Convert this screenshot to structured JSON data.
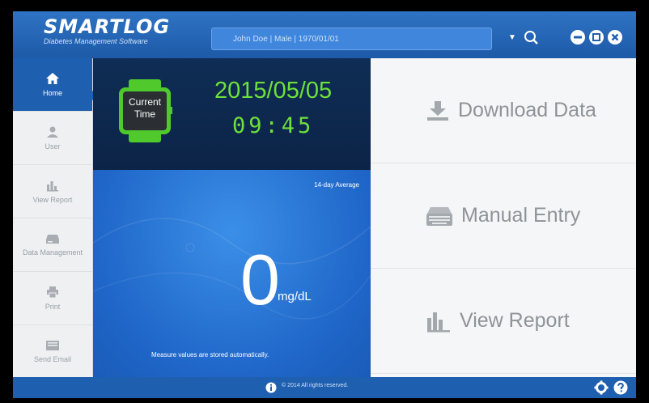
{
  "app": {
    "title": "SMARTLOG",
    "subtitle": "Diabetes Management Software"
  },
  "user_bar": {
    "text": "John Doe  |  Male  |  1970/01/01"
  },
  "sidebar": {
    "items": [
      {
        "label": "Home",
        "icon": "home-icon",
        "active": true
      },
      {
        "label": "User",
        "icon": "user-icon",
        "active": false
      },
      {
        "label": "View Report",
        "icon": "chart-icon",
        "active": false
      },
      {
        "label": "Data Management",
        "icon": "data-management-icon",
        "active": false
      },
      {
        "label": "Print",
        "icon": "printer-icon",
        "active": false
      },
      {
        "label": "Send Email",
        "icon": "email-icon",
        "active": false
      }
    ]
  },
  "time_panel": {
    "label_line1": "Current",
    "label_line2": "Time",
    "date": "2015/05/05",
    "time": "09:45"
  },
  "average": {
    "label": "14-day Average",
    "value": "0",
    "unit": "mg/dL",
    "note": "Measure values are stored automatically."
  },
  "actions": [
    {
      "label": "Download Data",
      "icon": "download-icon"
    },
    {
      "label": "Manual Entry",
      "icon": "keyboard-icon"
    },
    {
      "label": "View Report",
      "icon": "chart-icon"
    }
  ],
  "footer": {
    "copyright": "© 2014 All rights reserved."
  },
  "colors": {
    "brand_blue": "#1e5fb0",
    "digital_green": "#6ee03a",
    "action_text": "#8e9398"
  }
}
